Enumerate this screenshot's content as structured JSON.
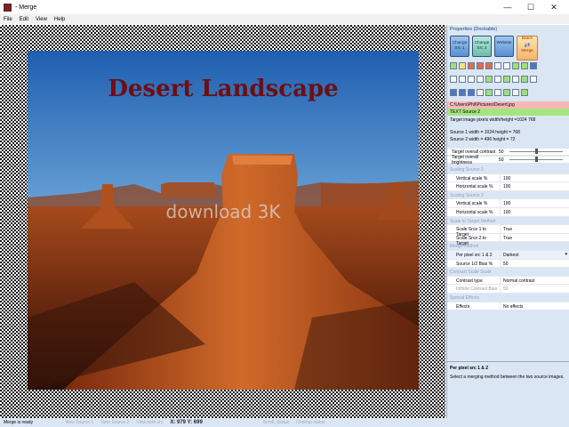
{
  "window": {
    "title": "- Merge",
    "minimize": "—",
    "maximize": "☐",
    "close": "✕"
  },
  "menu": [
    "File",
    "Edit",
    "View",
    "Help"
  ],
  "image": {
    "title": "Desert Landscape",
    "watermark": "download 3K"
  },
  "panel": {
    "header": "Properties (Dockable)",
    "buttons": {
      "change_src1": "Change Src 1",
      "change_src2": "Change Src 2",
      "website": "Website",
      "batch_top": "Batch",
      "batch_bottom": "Merge"
    },
    "path": "C:\\Users\\Phil\\Pictures\\Desert.jpg",
    "source2": "TEXT Source 2",
    "target_pixels": "Target image pixels width/height =1024 768",
    "source1_dims": "Source 1 width = 1024 height = 768",
    "source2_dims": "Source 2 width = 496 height = 72",
    "contrast_label": "Target overall contrast",
    "contrast_value": "50",
    "contrast_level": 0.5,
    "brightness_label": "Target overall brightness",
    "brightness_value": "50",
    "brightness_level": 0.5,
    "grid": {
      "scaling1": "Scaling Source 1",
      "vscale1_k": "Vertical scale %",
      "vscale1_v": "100",
      "hscale1_k": "Horizontal scale %",
      "hscale1_v": "100",
      "scaling2": "Scaling Source 2",
      "vscale2_k": "Vertical scale %",
      "vscale2_v": "100",
      "hscale2_k": "Horizontal scale %",
      "hscale2_v": "100",
      "scale_to_target": "Scale to Target Method",
      "s1_target_k": "Scale Srce 1 to Target",
      "s1_target_v": "True",
      "s2_target_k": "Scale Srce 2 to Target",
      "s2_target_v": "True",
      "merge_method": "Merge method",
      "perpixel_k": "Per pixel src 1 & 2",
      "perpixel_v": "Darkest",
      "bias_k": "Source 1/2 Bias %",
      "bias_v": "50",
      "contrast_scale": "Contrast Scale Scale",
      "contrast_type_k": "Contrast type",
      "contrast_type_v": "Normal contrast",
      "inf_bias_k": "Infinite Contrast Bias",
      "inf_bias_v": "50",
      "special": "Special Effects",
      "effects_k": "Effects",
      "effects_v": "No effects"
    },
    "desc_title": "Per pixel src 1 & 2",
    "desc_text": "Select a merging method between the two source images."
  },
  "status": {
    "ready": "Merge is ready",
    "view1": "View Source 1",
    "view2": "View Source 2",
    "viewboth": "View both src",
    "coords": "X: 979 Y: 699",
    "scroll": "Scroll_Status",
    "overlap": "Overlap status"
  },
  "colors": {
    "accent": "#1c3f7a",
    "title": "#6e0e12",
    "path_bg": "#f8b8b8",
    "src_bg": "#a6e57e"
  }
}
